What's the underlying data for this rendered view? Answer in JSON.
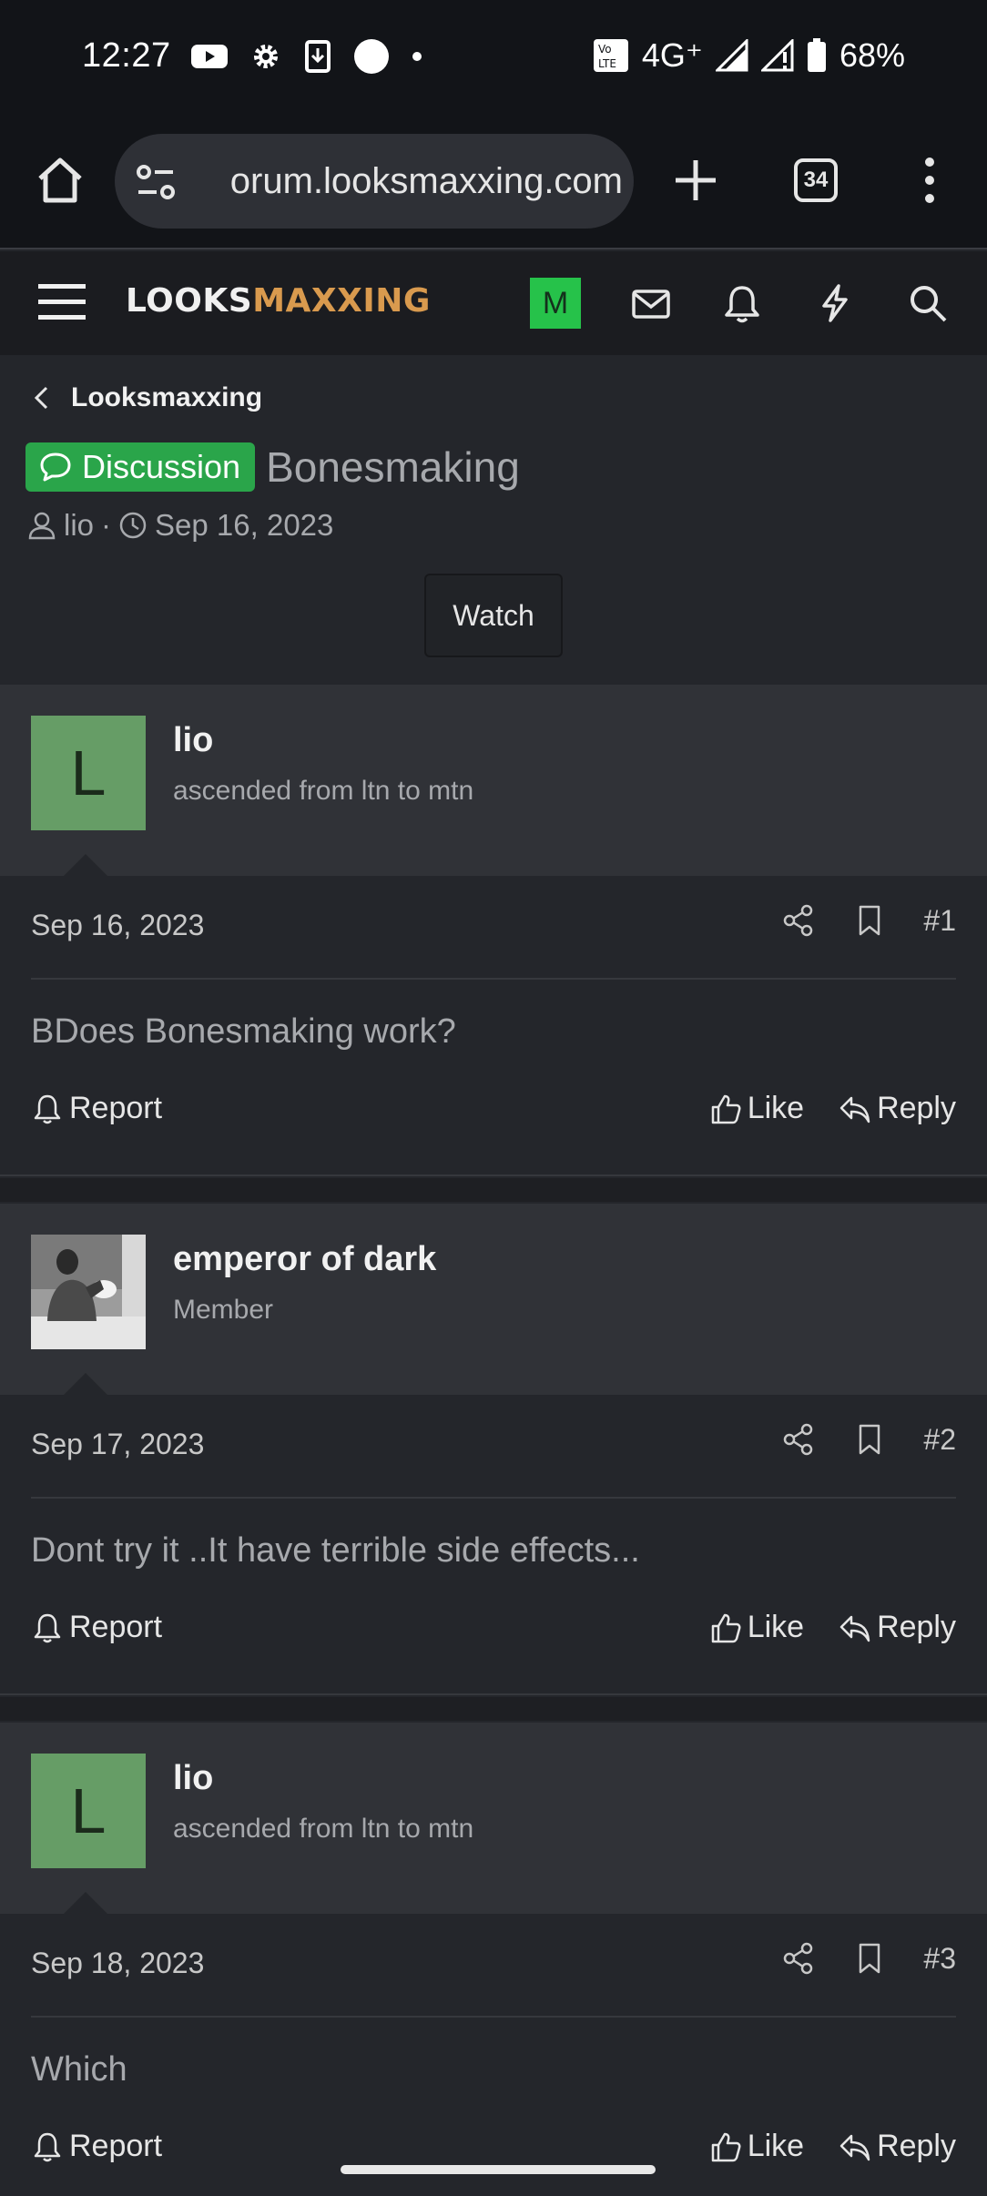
{
  "status_bar": {
    "time": "12:27",
    "network": "4G⁺",
    "battery": "68%"
  },
  "browser": {
    "url": "orum.looksmaxxing.com",
    "tab_count": "34"
  },
  "forum": {
    "logo_part1": "LOOKS",
    "logo_part2": "MAXXING",
    "user_initial": "M"
  },
  "thread": {
    "breadcrumb": "Looksmaxxing",
    "prefix": "Discussion",
    "title": "Bonesmaking",
    "author": "lio",
    "separator": "·",
    "date": "Sep 16, 2023",
    "watch_label": "Watch"
  },
  "post_labels": {
    "report": "Report",
    "like": "Like",
    "reply": "Reply"
  },
  "posts": [
    {
      "initial": "L",
      "username": "lio",
      "user_title": "ascended from ltn to mtn",
      "date": "Sep 16, 2023",
      "number": "#1",
      "text": "BDoes Bonesmaking work?"
    },
    {
      "initial": "",
      "username": "emperor of dark",
      "user_title": "Member",
      "date": "Sep 17, 2023",
      "number": "#2",
      "text": "Dont try it ..It have terrible side effects..."
    },
    {
      "initial": "L",
      "username": "lio",
      "user_title": "ascended from ltn to mtn",
      "date": "Sep 18, 2023",
      "number": "#3",
      "text": "Which"
    }
  ],
  "colors": {
    "discussion_badge": "#2aa54a",
    "logo_accent": "#d99a4e",
    "avatar_green": "#669d66",
    "user_avatar": "#26c24a"
  }
}
